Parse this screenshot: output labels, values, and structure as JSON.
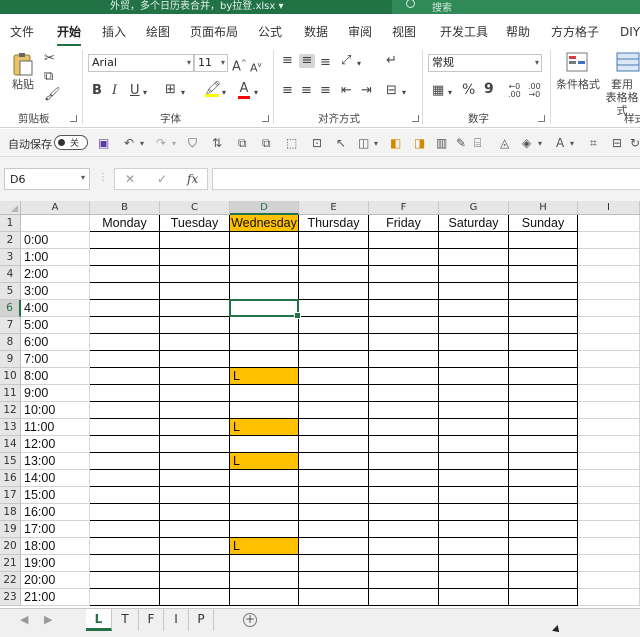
{
  "window": {
    "title": "外贸，多个日历表合并，by拉登.xlsx",
    "title_dropdown": "▾",
    "search_placeholder": "搜索"
  },
  "ribbon_tabs": [
    "文件",
    "开始",
    "插入",
    "绘图",
    "页面布局",
    "公式",
    "数据",
    "审阅",
    "视图",
    "开发工具",
    "帮助",
    "方方格子",
    "DIY工"
  ],
  "active_tab_index": 1,
  "ribbon": {
    "clipboard": {
      "paste_label": "粘贴",
      "group_label": "剪贴板"
    },
    "font": {
      "name": "Arial",
      "size": "11",
      "group_label": "字体",
      "bold": "B",
      "italic": "I",
      "underline": "U",
      "grow": "A",
      "shrink": "A",
      "font_color_glyph": "A",
      "highlight_color": "#ffff00",
      "font_color": "#ff0000"
    },
    "alignment": {
      "group_label": "对齐方式"
    },
    "number": {
      "format": "常规",
      "group_label": "数字",
      "percent": "%",
      "comma": "9"
    },
    "styles": {
      "cond_format_label": "条件格式",
      "table_format_label_1": "套用",
      "table_format_label_2": "表格格式",
      "group_label": "样式"
    }
  },
  "quick_access": {
    "autosave_label": "自动保存",
    "autosave_state": "关"
  },
  "formula_bar": {
    "name_box": "D6",
    "cancel": "✕",
    "enter": "✓",
    "fx": "fx",
    "content": ""
  },
  "columns": [
    "A",
    "B",
    "C",
    "D",
    "E",
    "F",
    "G",
    "H",
    "I"
  ],
  "selected_column": "D",
  "selected_row": 6,
  "weekdays": [
    "Monday",
    "Tuesday",
    "Wednesday",
    "Thursday",
    "Friday",
    "Saturday",
    "Sunday"
  ],
  "highlighted_header": "Wednesday",
  "rows": [
    {
      "n": "1",
      "a": ""
    },
    {
      "n": "2",
      "a": "0:00"
    },
    {
      "n": "3",
      "a": "1:00"
    },
    {
      "n": "4",
      "a": "2:00"
    },
    {
      "n": "5",
      "a": "3:00"
    },
    {
      "n": "6",
      "a": "4:00"
    },
    {
      "n": "7",
      "a": "5:00"
    },
    {
      "n": "8",
      "a": "6:00"
    },
    {
      "n": "9",
      "a": "7:00"
    },
    {
      "n": "10",
      "a": "8:00"
    },
    {
      "n": "11",
      "a": "9:00"
    },
    {
      "n": "12",
      "a": "10:00"
    },
    {
      "n": "13",
      "a": "11:00"
    },
    {
      "n": "14",
      "a": "12:00"
    },
    {
      "n": "15",
      "a": "13:00"
    },
    {
      "n": "16",
      "a": "14:00"
    },
    {
      "n": "17",
      "a": "15:00"
    },
    {
      "n": "18",
      "a": "16:00"
    },
    {
      "n": "19",
      "a": "17:00"
    },
    {
      "n": "20",
      "a": "18:00"
    },
    {
      "n": "21",
      "a": "19:00"
    },
    {
      "n": "22",
      "a": "20:00"
    },
    {
      "n": "23",
      "a": "21:00"
    }
  ],
  "marked_cells": [
    {
      "row": 10,
      "col": "D",
      "value": "L"
    },
    {
      "row": 13,
      "col": "D",
      "value": "L"
    },
    {
      "row": 15,
      "col": "D",
      "value": "L"
    },
    {
      "row": 20,
      "col": "D",
      "value": "L"
    }
  ],
  "colors": {
    "excel_green": "#217346",
    "highlight": "#ffc000"
  },
  "sheet_tabs": [
    "L",
    "T",
    "F",
    "I",
    "P"
  ],
  "active_sheet": "L",
  "add_sheet": "+"
}
